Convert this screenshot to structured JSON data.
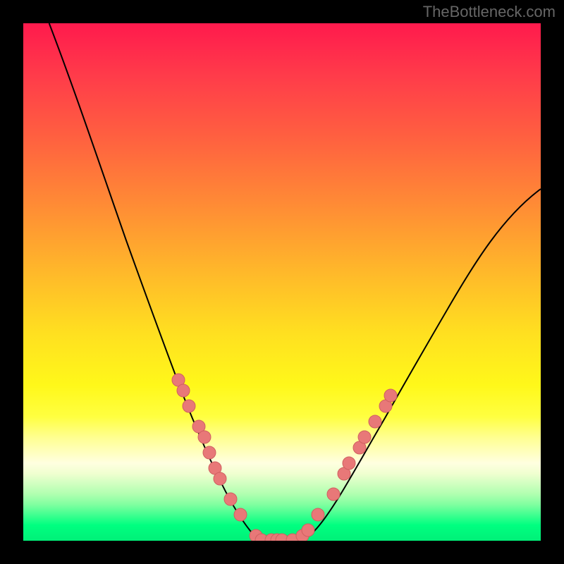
{
  "watermark": "TheBottleneck.com",
  "chart_data": {
    "type": "line",
    "title": "",
    "xlabel": "",
    "ylabel": "",
    "xlim": [
      0,
      100
    ],
    "ylim": [
      0,
      100
    ],
    "series": [
      {
        "name": "bottleneck-curve",
        "x": [
          5,
          10,
          15,
          20,
          25,
          28,
          30,
          32,
          34,
          36,
          38,
          40,
          42,
          44,
          46,
          48,
          50,
          52,
          54,
          56,
          58,
          62,
          66,
          70,
          75,
          80,
          85,
          90,
          95,
          100
        ],
        "y": [
          100,
          87,
          72,
          58,
          44,
          36,
          31,
          26,
          22,
          18,
          14,
          10,
          6,
          3,
          1,
          0,
          0,
          0,
          1,
          3,
          6,
          12,
          19,
          25,
          33,
          41,
          48,
          55,
          62,
          68
        ]
      }
    ],
    "scatter_points": {
      "name": "highlighted-hardware-points",
      "points": [
        {
          "x": 30,
          "y": 31
        },
        {
          "x": 31,
          "y": 29
        },
        {
          "x": 32,
          "y": 26
        },
        {
          "x": 34,
          "y": 22
        },
        {
          "x": 35,
          "y": 20
        },
        {
          "x": 36,
          "y": 17
        },
        {
          "x": 37,
          "y": 14
        },
        {
          "x": 38,
          "y": 12
        },
        {
          "x": 40,
          "y": 8
        },
        {
          "x": 42,
          "y": 5
        },
        {
          "x": 45,
          "y": 1
        },
        {
          "x": 46,
          "y": 0
        },
        {
          "x": 48,
          "y": 0
        },
        {
          "x": 49,
          "y": 0
        },
        {
          "x": 50,
          "y": 0
        },
        {
          "x": 52,
          "y": 0
        },
        {
          "x": 54,
          "y": 1
        },
        {
          "x": 55,
          "y": 2
        },
        {
          "x": 57,
          "y": 5
        },
        {
          "x": 60,
          "y": 9
        },
        {
          "x": 62,
          "y": 13
        },
        {
          "x": 63,
          "y": 15
        },
        {
          "x": 65,
          "y": 18
        },
        {
          "x": 66,
          "y": 20
        },
        {
          "x": 68,
          "y": 23
        },
        {
          "x": 70,
          "y": 26
        },
        {
          "x": 71,
          "y": 28
        }
      ]
    },
    "background": "rainbow-gradient-red-to-green-vertical"
  }
}
